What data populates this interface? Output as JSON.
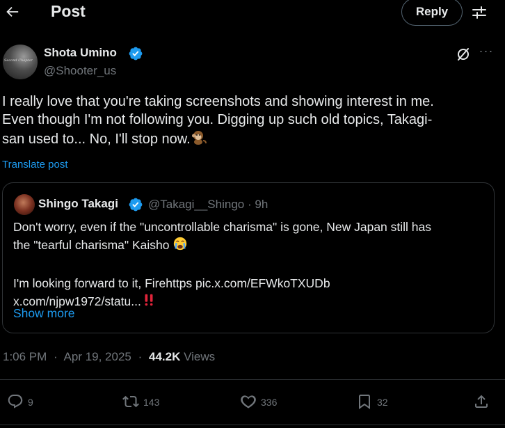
{
  "header": {
    "title": "Post",
    "reply_label": "Reply"
  },
  "post": {
    "author": {
      "name": "Shota Umino",
      "handle": "@Shooter_us",
      "avatar_text": "Second Chapter"
    },
    "text_lines": [
      "I really love that you're taking screenshots and showing interest in me.",
      "Even though I'm not following you. Digging up such old topics, Takagi-",
      "san used to... No, I'll stop now."
    ],
    "translate_label": "Translate post",
    "quote": {
      "name": "Shingo Takagi",
      "handle": "@Takagi__Shingo",
      "time": "9h",
      "text_lines": [
        "Don't worry, even if the \"uncontrollable charisma\" is gone, New Japan still has",
        "the \"tearful charisma\" Kaisho",
        "",
        "I'm looking forward to it, Firehttps  pic.x.com/EFWkoTXUDb",
        "x.com/njpw1972/statu..."
      ],
      "show_more_label": "Show more"
    },
    "meta": {
      "time": "1:06 PM",
      "date": "Apr 19, 2025",
      "views_count": "44.2K",
      "views_label": "Views"
    }
  },
  "actions": {
    "replies": "9",
    "reposts": "143",
    "likes": "336",
    "bookmarks": "32"
  },
  "colors": {
    "background": "#000000",
    "text": "#e7e9ea",
    "muted": "#71767b",
    "accent": "#1d9bf0",
    "border": "#2f3336"
  }
}
